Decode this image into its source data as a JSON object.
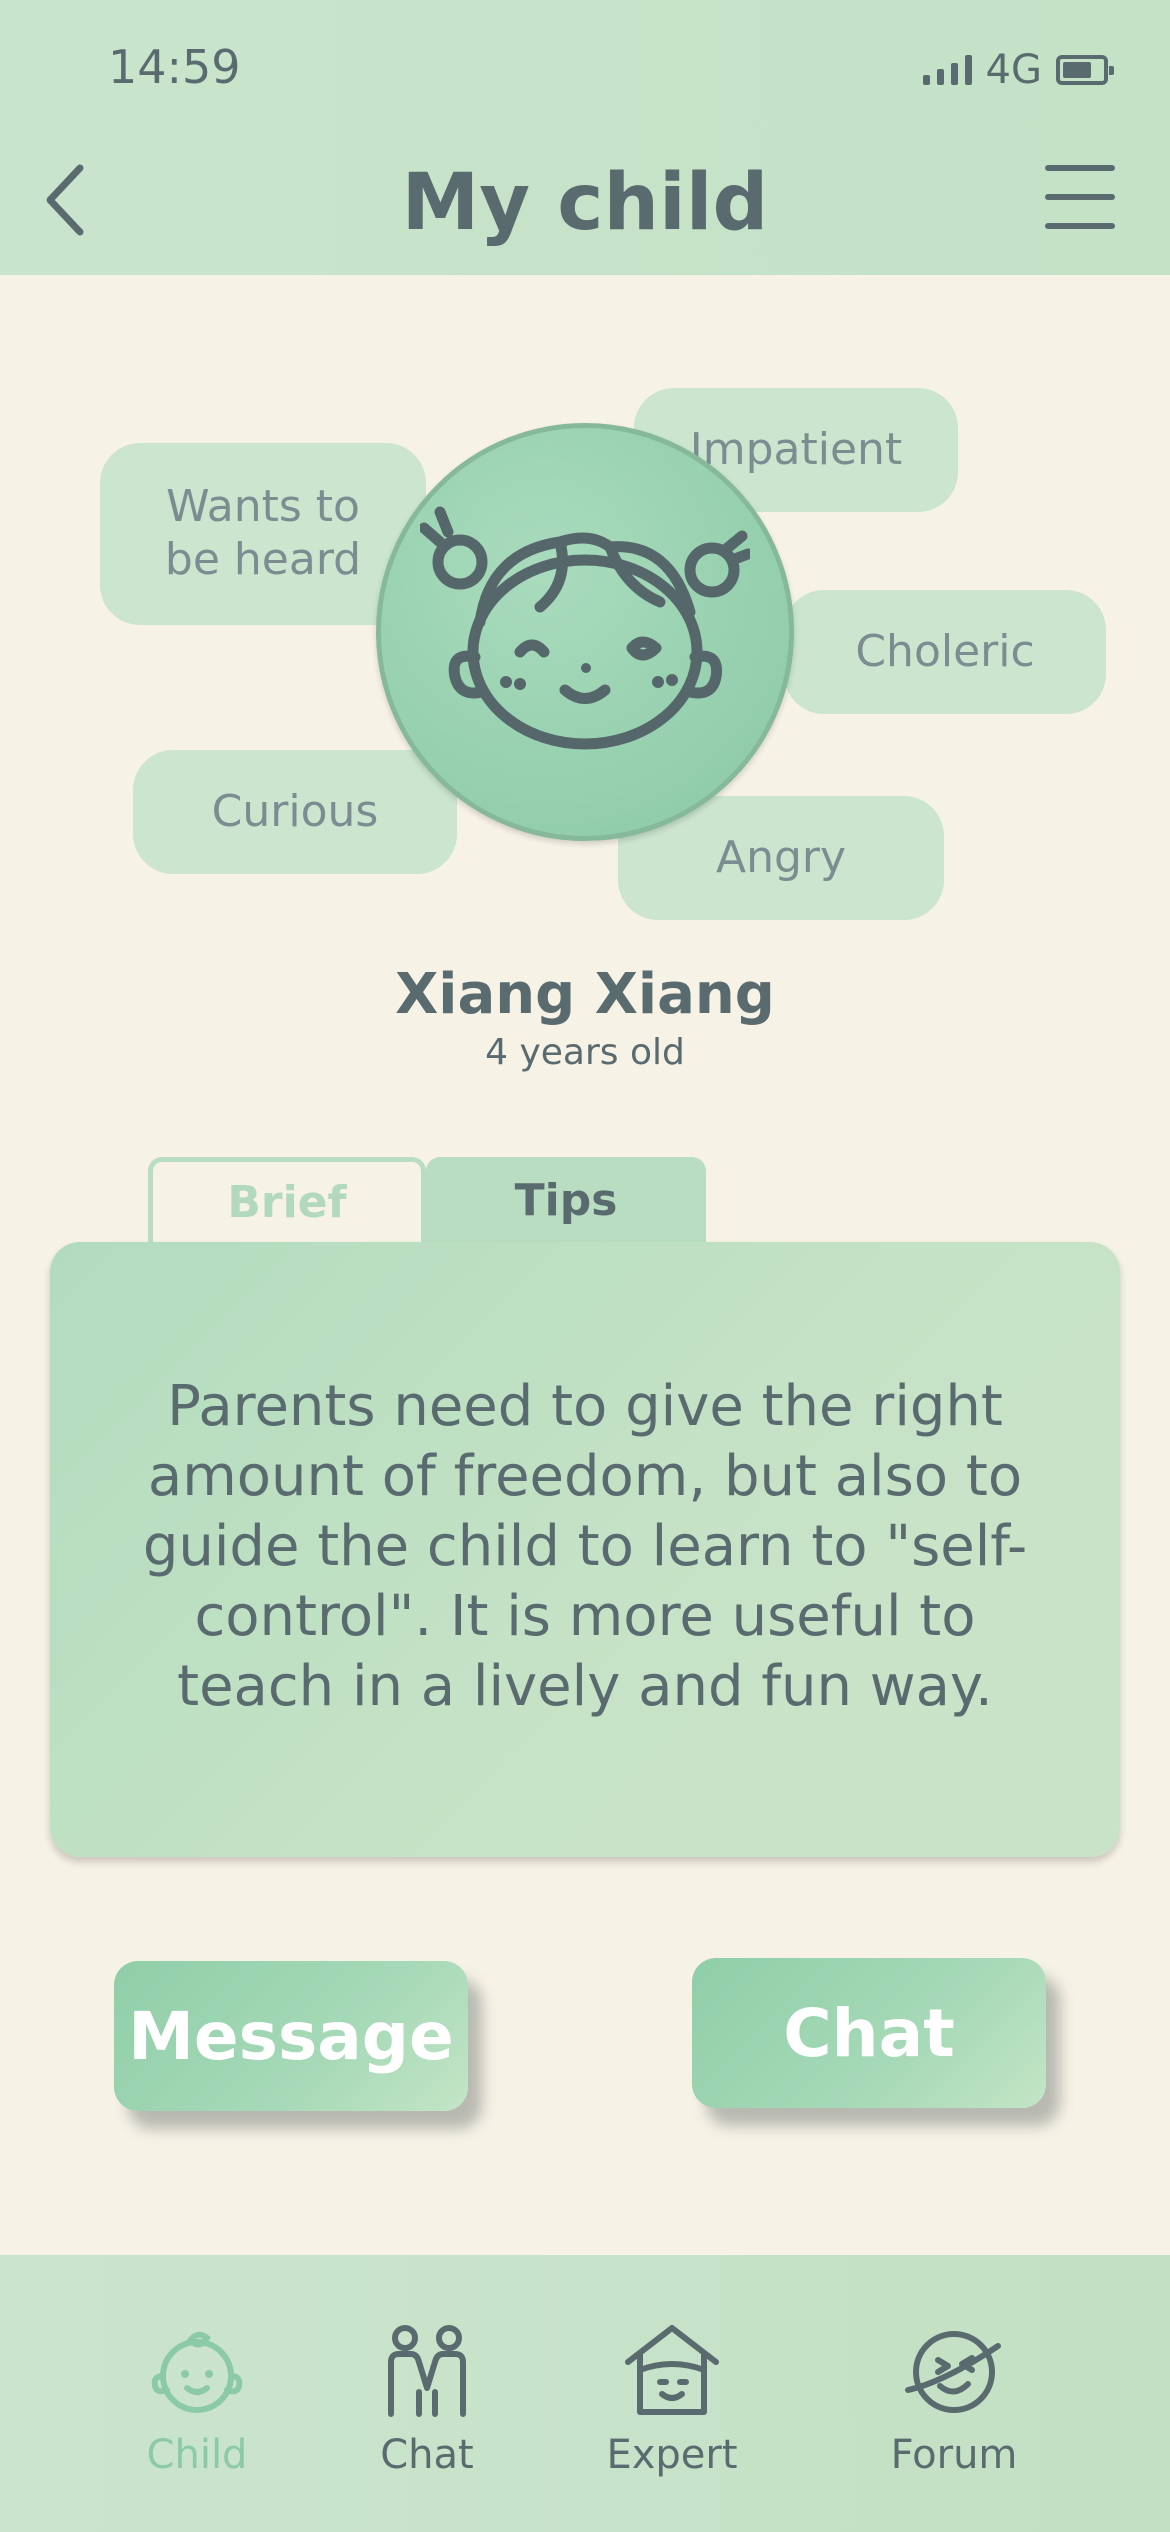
{
  "status_bar": {
    "time": "14:59",
    "network": "4G"
  },
  "header": {
    "title": "My child"
  },
  "traits": [
    "Impatient",
    "Wants to\nbe heard",
    "Choleric",
    "Curious",
    "Angry"
  ],
  "child": {
    "name": "Xiang Xiang",
    "age": "4 years old"
  },
  "tabs": [
    {
      "label": "Brief",
      "active": false
    },
    {
      "label": "Tips",
      "active": true
    }
  ],
  "tips": {
    "text": "Parents need to give the right amount of freedom, but also to guide the child to learn to \"self-control\". It is more useful to teach in a lively and fun way."
  },
  "actions": {
    "message_label": "Message",
    "chat_label": "Chat"
  },
  "bottom_nav": [
    {
      "label": "Child",
      "icon": "child-face-icon",
      "active": true
    },
    {
      "label": "Chat",
      "icon": "people-icon",
      "active": false
    },
    {
      "label": "Expert",
      "icon": "house-face-icon",
      "active": false
    },
    {
      "label": "Forum",
      "icon": "planet-face-icon",
      "active": false
    }
  ],
  "colors": {
    "header_bg": "#c6e2c9",
    "page_bg": "#f6f2e6",
    "accent": "#8ccaa7",
    "text": "#5a6b70",
    "trait_bg": "#cbe5ce"
  }
}
